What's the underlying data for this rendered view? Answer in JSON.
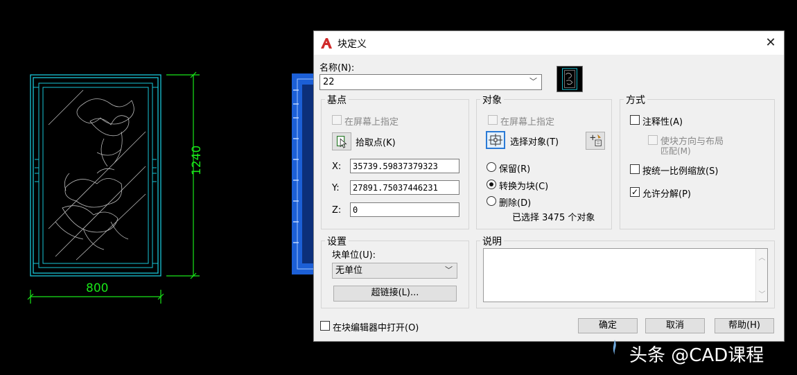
{
  "drawing": {
    "width_label": "800",
    "height_label": "1240"
  },
  "dialog": {
    "title": "块定义",
    "name_label": "名称(N):",
    "name_value": "22",
    "base_point": {
      "group_title": "基点",
      "specify_on_screen": "在屏幕上指定",
      "pick_point": "拾取点(K)",
      "x_label": "X:",
      "x_value": "35739.59837379323",
      "y_label": "Y:",
      "y_value": "27891.75037446231",
      "z_label": "Z:",
      "z_value": "0"
    },
    "objects": {
      "group_title": "对象",
      "specify_on_screen": "在屏幕上指定",
      "select_objects": "选择对象(T)",
      "retain": "保留(R)",
      "convert_to_block": "转换为块(C)",
      "delete": "删除(D)",
      "selected_count": "已选择 3475 个对象"
    },
    "behavior": {
      "group_title": "方式",
      "annotative": "注释性(A)",
      "match_orientation_line1": "使块方向与布局",
      "match_orientation_line2": "匹配(M)",
      "scale_uniformly": "按统一比例缩放(S)",
      "allow_exploding": "允许分解(P)"
    },
    "settings": {
      "group_title": "设置",
      "block_unit_label": "块单位(U):",
      "block_unit_value": "无单位",
      "hyperlink_button": "超链接(L)..."
    },
    "description": {
      "group_title": "说明",
      "value": ""
    },
    "open_in_editor": "在块编辑器中打开(O)",
    "ok_button": "确定",
    "cancel_button": "取消",
    "help_button": "帮助(H)"
  },
  "watermark": {
    "text": "头条 @CAD课程"
  },
  "colors": {
    "cad_background": "#000000",
    "frame_cyan": "#19c6d8",
    "dimension_green": "#19e619",
    "dialog_background": "#f0f0f0",
    "focus_blue": "#2a7ad6",
    "autocad_red": "#d02a2a"
  }
}
